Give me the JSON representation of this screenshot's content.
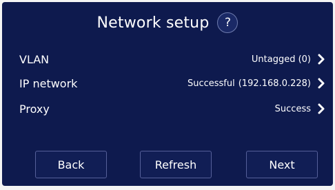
{
  "header": {
    "title": "Network setup",
    "help_label": "?"
  },
  "rows": [
    {
      "label": "VLAN",
      "status": "Untagged (0)",
      "icon": "chevron-right-icon"
    },
    {
      "label": "IP network",
      "status": "Successful",
      "address": "(192.168.0.228)",
      "icon": "chevron-right-icon"
    },
    {
      "label": "Proxy",
      "status": "Success",
      "icon": "chevron-right-icon"
    }
  ],
  "footer": {
    "back_label": "Back",
    "refresh_label": "Refresh",
    "next_label": "Next"
  },
  "colors": {
    "background": "#0e1a4e",
    "button_border": "#56609a",
    "text": "#ffffff"
  }
}
